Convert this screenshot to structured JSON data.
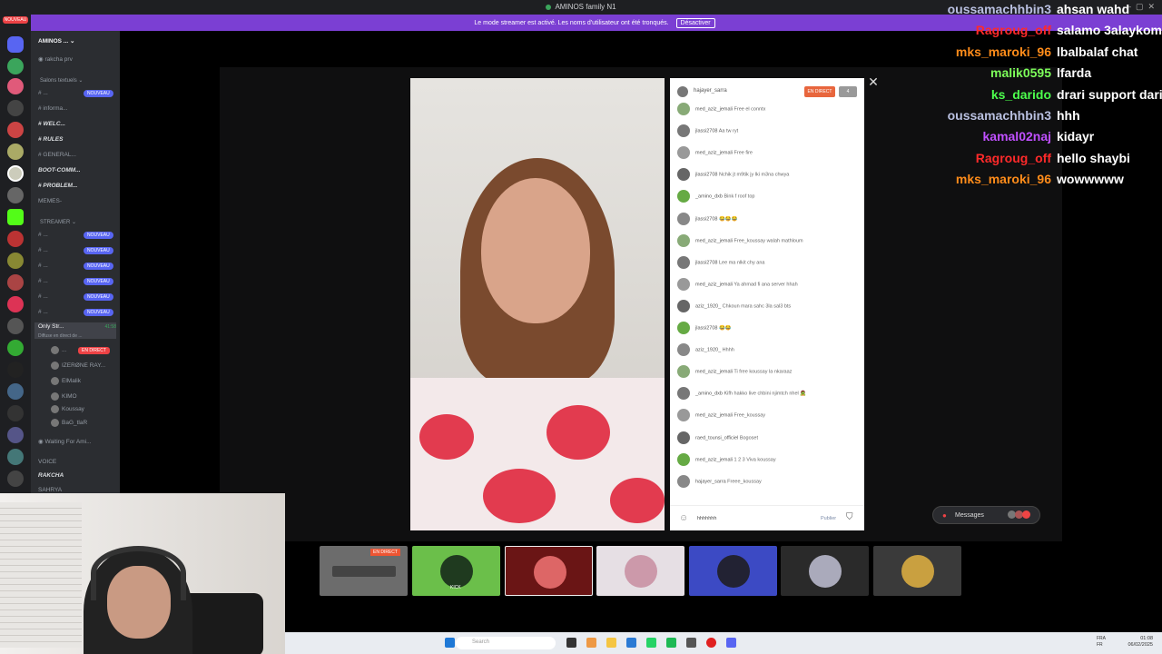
{
  "window": {
    "title": "AMINOS family N1"
  },
  "banner": {
    "text": "Le mode streamer est activé. Les noms d'utilisateur ont été tronqués.",
    "button": "Désactiver"
  },
  "rail": {
    "badge": "NOUVEAU"
  },
  "server": {
    "name": "AMINOS ...",
    "top_channel": "rakcha prv",
    "category_text": "Salons textuels",
    "text_channels": [
      {
        "label": "# ...",
        "badge": "NOUVEAU"
      },
      {
        "label": "# informa...",
        "badge": ""
      },
      {
        "label": "# WELC...",
        "badge": ""
      },
      {
        "label": "# RULES",
        "badge": ""
      },
      {
        "label": "# GENERAL...",
        "badge": ""
      },
      {
        "label": "BOOT-COMM...",
        "badge": ""
      },
      {
        "label": "# PROBLEM...",
        "badge": ""
      },
      {
        "label": "MEMES-",
        "badge": ""
      }
    ],
    "category_streamer": "STREAMER",
    "streamer_channels": [
      {
        "label": "# ...",
        "badge": "NOUVEAU"
      },
      {
        "label": "# ...",
        "badge": "NOUVEAU"
      },
      {
        "label": "# ...",
        "badge": "NOUVEAU"
      },
      {
        "label": "# ...",
        "badge": "NOUVEAU"
      },
      {
        "label": "# ...",
        "badge": "NOUVEAU"
      },
      {
        "label": "# ...",
        "badge": "NOUVEAU"
      }
    ],
    "voice_active": {
      "label": "Only Str...",
      "sub": "Diffuse en direct de ...",
      "time": "41:58"
    },
    "voice_users": [
      {
        "name": "...",
        "live": "EN DIRECT"
      },
      {
        "name": "IZERØNE RAY...",
        "live": ""
      },
      {
        "name": "ElMalik",
        "live": ""
      },
      {
        "name": "KIMO",
        "live": ""
      },
      {
        "name": "Koussay",
        "live": ""
      },
      {
        "name": "BaG_tlaR",
        "live": ""
      }
    ],
    "waiting": "Waiting For Ami...",
    "voice_cat": "VOICE",
    "voice_ch1": "RAKCHA",
    "voice_ch2": "SAHRYA"
  },
  "live_chat": {
    "host": "hajayer_sarra",
    "live_label": "EN DIRECT",
    "viewer_count": "4",
    "messages": [
      {
        "user": "med_aziz_jemali",
        "text": "Free el conntx"
      },
      {
        "user": "jlassi2708",
        "text": "Aa tw ryt"
      },
      {
        "user": "med_aziz_jemali",
        "text": "Free fire"
      },
      {
        "user": "jlassi2708",
        "text": "Nchik jt m9tik jy lki m3na chwya"
      },
      {
        "user": "_amino_dxb",
        "text": "Bink f roof top"
      },
      {
        "user": "jlassi2708",
        "text": "😂😂😂"
      },
      {
        "user": "med_aziz_jemali",
        "text": "Free_koussay walah mathloum"
      },
      {
        "user": "jlassi2708",
        "text": "Lee ma nlkit chy ana"
      },
      {
        "user": "med_aziz_jemali",
        "text": "Ya ahmad fi ana server hhah"
      },
      {
        "user": "aziz_1920_",
        "text": "Chkoun mara sahc 3la sal3 bts"
      },
      {
        "user": "jlassi2708",
        "text": "😂😂"
      },
      {
        "user": "aziz_1920_",
        "text": "Hhhh"
      },
      {
        "user": "med_aziz_jemali",
        "text": "Ti free koussay la nkaraaz"
      },
      {
        "user": "_amino_dxb",
        "text": "Kifh hakko live chbini njimtch nhel 🧟"
      },
      {
        "user": "med_aziz_jemali",
        "text": "Free_koussay"
      },
      {
        "user": "raed_tounsi_officiel",
        "text": "Bogoset"
      },
      {
        "user": "med_aziz_jemali",
        "text": "1 2 3 Viva koussay"
      },
      {
        "user": "hajayer_sarra",
        "text": "Freee_koussay"
      }
    ],
    "input_value": "hhhhhhh",
    "publish": "Publier"
  },
  "messages_button": "Messages",
  "thumbnail_live": "EN DIRECT",
  "thumbnail_kick": "KICK",
  "stream_chat": [
    {
      "user": "oussamachhbin3",
      "text": "ahsan wahd",
      "color": "#b9c0e0"
    },
    {
      "user": "Ragroug_off",
      "text": "salamo 3alaykom",
      "color": "#ff2a2a"
    },
    {
      "user": "mks_maroki_96",
      "text": "lbalbalaf chat",
      "color": "#ff8c1a"
    },
    {
      "user": "malik0595",
      "text": "lfarda",
      "color": "#7dff5a"
    },
    {
      "user": "ks_darido",
      "text": "drari support dari",
      "color": "#4dff4d"
    },
    {
      "user": "oussamachhbin3",
      "text": "hhh",
      "color": "#b9c0e0"
    },
    {
      "user": "kamal02naj",
      "text": "kidayr",
      "color": "#c050ff"
    },
    {
      "user": "Ragroug_off",
      "text": "hello shaybi",
      "color": "#ff2a2a"
    },
    {
      "user": "mks_maroki_96",
      "text": "wowwwww",
      "color": "#ff8c1a"
    }
  ],
  "taskbar": {
    "search": "Search",
    "lang_top": "FRA",
    "lang_bottom": "FR",
    "time": "01:08",
    "date": "06/02/2025"
  }
}
